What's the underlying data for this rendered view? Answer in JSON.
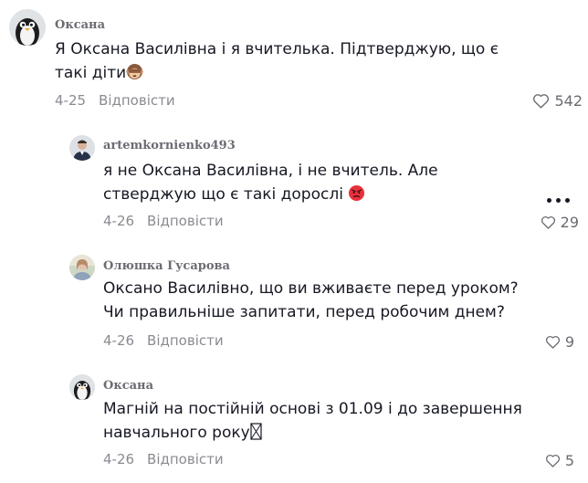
{
  "comments": [
    {
      "username": "Оксана",
      "text": "Я Оксана Василівна і я вчителька. Підтверджую, що є такі діти",
      "emoji": "see-no-evil-monkey",
      "date": "4-25",
      "reply_label": "Відповісти",
      "likes": "542"
    },
    {
      "username": "artemkornienko493",
      "text": "я не Оксана Василівна, і не вчитель. Але стверджую що є такі дорослі",
      "emoji": "angry-face",
      "date": "4-26",
      "reply_label": "Відповісти",
      "likes": "29"
    },
    {
      "username": "Олюшка Гусарова",
      "text": "Оксано Василівно, що ви вживаєте перед уроком? Чи правильніше запитати, перед робочим днем?",
      "date": "4-26",
      "reply_label": "Відповісти",
      "likes": "9"
    },
    {
      "username": "Оксана",
      "text": "Магній на постійній основі з 01.09 і до завершення навчального року",
      "emoji": "missing-glyph",
      "date": "4-26",
      "reply_label": "Відповісти",
      "likes": "5"
    }
  ],
  "icons": {
    "like": "heart-outline-icon",
    "more": "more-horizontal-icon"
  },
  "colors": {
    "text": "#161823",
    "muted": "#8a8b91",
    "username": "#6b6c73"
  }
}
